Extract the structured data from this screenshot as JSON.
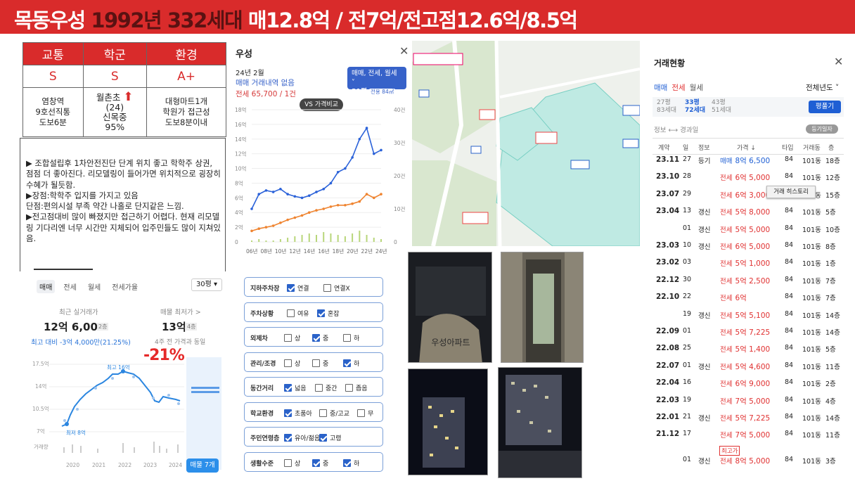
{
  "header": {
    "part1": "목동우성 ",
    "part2": "1992년 332세대",
    "part3": " 매12.8억 / 전7억/전고점12.6억/8.5억"
  },
  "grade_table": {
    "headers": [
      "교통",
      "학군",
      "환경"
    ],
    "grades": [
      "S",
      "S",
      "A+"
    ],
    "desc": [
      [
        "염창역",
        "9호선직통",
        "도보6분"
      ],
      [
        "월촌초",
        "(24)",
        "신목중",
        "95%"
      ],
      [
        "대형마트1개",
        "학원가 접근성",
        "도보8분이내"
      ]
    ],
    "arrow": "⬆"
  },
  "note": {
    "lines": [
      "▶ 조합설립후 1차안전진단 단계 위치 좋고 학학주 상권, 점점 더 좋아진다. 리모델링이 들어가면 위치적으로 굉장히 수혜가 될듯함.",
      "▶장점:학학주 입지를 가지고 있음",
      "단점:편의시설 부족 약간 나홀로 단지같은 느낌.",
      "▶전고점대비 많이 빠졌지만 접근하기 어렵다. 현재 리모델링 기다리엔 너무 시간만 지체되어 입주민들도 많이 지쳐있음."
    ]
  },
  "price_panel": {
    "tabs": [
      "매매",
      "전세",
      "월세",
      "전세가율"
    ],
    "pyeong_select": "30평 ▾",
    "recent_label": "최근 실거래가",
    "recent_value": "12억 6,000",
    "recent_floor": "2층",
    "min_label": "매물 최저가 >",
    "min_value": "13억",
    "min_floor": "4층",
    "recent_diff": "최고 대비 -3억 4,000만(21.25%)",
    "min_note": "4주 전 가격과 동일",
    "big_change": "-21%",
    "y_labels": [
      "17.5억",
      "14억",
      "10.5억",
      "7억",
      "거래량"
    ],
    "x_labels": [
      "2020",
      "2021",
      "2022",
      "2023",
      "2024"
    ],
    "peak_label": "최고 16억",
    "low_label": "최저 8억",
    "listing_button": "매물 7개"
  },
  "chart_panel": {
    "title": "우성",
    "close": "✕",
    "date": "24년 2월",
    "sub1": "매매 거래내역 없음",
    "sub2": "전세 65,700 / 1건",
    "type_btn_line1": "매매, 전세, 월세 ˅",
    "type_btn_py": "31평",
    "type_btn_area": "전용 84㎡",
    "vs_button": "VS 가격비교",
    "y_left": [
      "18억",
      "16억",
      "14억",
      "12억",
      "10억",
      "8억",
      "6억",
      "4억",
      "2억",
      "0"
    ],
    "y_right": [
      "40건",
      "30건",
      "20건",
      "10건",
      "0"
    ],
    "x_labels": [
      "06년",
      "08년",
      "10년",
      "12년",
      "14년",
      "16년",
      "18년",
      "20년",
      "22년",
      "24년"
    ]
  },
  "chart_data": {
    "type": "line",
    "x": [
      "06년",
      "07년",
      "08년",
      "09년",
      "10년",
      "11년",
      "12년",
      "13년",
      "14년",
      "15년",
      "16년",
      "17년",
      "18년",
      "19년",
      "20년",
      "21년",
      "22년",
      "23년",
      "24년"
    ],
    "series": [
      {
        "name": "매매",
        "values": [
          4.5,
          6.5,
          7.0,
          6.8,
          7.2,
          6.5,
          6.2,
          6.0,
          6.3,
          6.8,
          7.2,
          8.0,
          9.5,
          10.0,
          11.5,
          14.0,
          15.5,
          12.0,
          12.5
        ]
      },
      {
        "name": "전세",
        "values": [
          1.5,
          1.8,
          2.0,
          2.2,
          2.6,
          3.0,
          3.3,
          3.6,
          4.0,
          4.3,
          4.5,
          4.8,
          5.0,
          5.0,
          5.2,
          5.5,
          6.5,
          6.0,
          6.5
        ]
      }
    ],
    "ylim": [
      0,
      18
    ],
    "xlabel": "",
    "ylabel": ""
  },
  "checklist": [
    {
      "label": "지하주차장",
      "opts": [
        {
          "t": "연결",
          "on": true
        },
        {
          "t": "연결X",
          "on": false
        }
      ]
    },
    {
      "label": "주차상황",
      "opts": [
        {
          "t": "여유",
          "on": false
        },
        {
          "t": "혼잡",
          "on": true
        }
      ]
    },
    {
      "label": "외제차",
      "opts": [
        {
          "t": "상",
          "on": false
        },
        {
          "t": "중",
          "on": true
        },
        {
          "t": "하",
          "on": false
        }
      ]
    },
    {
      "label": "관리/조경",
      "opts": [
        {
          "t": "상",
          "on": false
        },
        {
          "t": "중",
          "on": false
        },
        {
          "t": "하",
          "on": true
        }
      ]
    },
    {
      "label": "동간거리",
      "opts": [
        {
          "t": "넓음",
          "on": true
        },
        {
          "t": "중간",
          "on": false
        },
        {
          "t": "좁음",
          "on": false
        }
      ]
    },
    {
      "label": "학교환경",
      "opts": [
        {
          "t": "초품아",
          "on": true
        },
        {
          "t": "중/고교",
          "on": false
        },
        {
          "t": "무",
          "on": false
        }
      ]
    },
    {
      "label": "주민연령층",
      "opts": [
        {
          "t": "유아/젊음",
          "on": true
        },
        {
          "t": "고령",
          "on": true
        }
      ]
    },
    {
      "label": "생활수준",
      "opts": [
        {
          "t": "상",
          "on": false
        },
        {
          "t": "중",
          "on": true
        },
        {
          "t": "하",
          "on": true
        }
      ]
    }
  ],
  "photo_sign": "우성아파트",
  "transactions": {
    "title": "거래현황",
    "close": "✕",
    "tabs": [
      "매매",
      "전세",
      "월세"
    ],
    "year_select": "전체년도 ˅",
    "py_options": [
      {
        "py": "27평",
        "units": "83세대"
      },
      {
        "py": "33평",
        "units": "72세대"
      },
      {
        "py": "43평",
        "units": "51세대"
      }
    ],
    "py_button": "평풀기",
    "info_label": "정보 ⟷ 경과일",
    "reg_badge": "등기일자",
    "headers": [
      "계약",
      "일",
      "정보",
      "가격 ↓",
      "타입",
      "거래동",
      "층"
    ],
    "tooltip": "거래 히스토리",
    "max_badge": "최고가",
    "rows": [
      {
        "date": "23.11",
        "day": "27",
        "info": "등기",
        "kind": "매매",
        "price": "8억 6,500",
        "type": "84",
        "dong": "101동",
        "floor": "18층"
      },
      {
        "date": "23.10",
        "day": "28",
        "info": "",
        "kind": "전세",
        "price": "6억 5,000",
        "type": "84",
        "dong": "101동",
        "floor": "12층"
      },
      {
        "date": "23.07",
        "day": "29",
        "info": "",
        "kind": "전세",
        "price": "6억 3,000",
        "type": "84",
        "dong": "101동",
        "floor": "15층"
      },
      {
        "date": "23.04",
        "day": "13",
        "info": "갱신",
        "kind": "전세",
        "price": "5억 8,000",
        "type": "84",
        "dong": "101동",
        "floor": "5층"
      },
      {
        "date": "",
        "day": "01",
        "info": "갱신",
        "kind": "전세",
        "price": "5억 5,000",
        "type": "84",
        "dong": "101동",
        "floor": "10층"
      },
      {
        "date": "23.03",
        "day": "10",
        "info": "갱신",
        "kind": "전세",
        "price": "6억 5,000",
        "type": "84",
        "dong": "101동",
        "floor": "8층"
      },
      {
        "date": "23.02",
        "day": "03",
        "info": "",
        "kind": "전세",
        "price": "5억 1,000",
        "type": "84",
        "dong": "101동",
        "floor": "1층"
      },
      {
        "date": "22.12",
        "day": "30",
        "info": "",
        "kind": "전세",
        "price": "5억 2,500",
        "type": "84",
        "dong": "101동",
        "floor": "7층"
      },
      {
        "date": "22.10",
        "day": "22",
        "info": "",
        "kind": "전세",
        "price": "6억",
        "type": "84",
        "dong": "101동",
        "floor": "7층"
      },
      {
        "date": "",
        "day": "19",
        "info": "갱신",
        "kind": "전세",
        "price": "5억 5,100",
        "type": "84",
        "dong": "101동",
        "floor": "14층"
      },
      {
        "date": "22.09",
        "day": "01",
        "info": "",
        "kind": "전세",
        "price": "5억 7,225",
        "type": "84",
        "dong": "101동",
        "floor": "14층"
      },
      {
        "date": "22.08",
        "day": "25",
        "info": "",
        "kind": "전세",
        "price": "5억 1,400",
        "type": "84",
        "dong": "101동",
        "floor": "5층"
      },
      {
        "date": "22.07",
        "day": "01",
        "info": "갱신",
        "kind": "전세",
        "price": "5억 4,600",
        "type": "84",
        "dong": "101동",
        "floor": "11층"
      },
      {
        "date": "22.04",
        "day": "16",
        "info": "",
        "kind": "전세",
        "price": "6억 9,000",
        "type": "84",
        "dong": "101동",
        "floor": "2층"
      },
      {
        "date": "22.03",
        "day": "19",
        "info": "",
        "kind": "전세",
        "price": "7억 5,000",
        "type": "84",
        "dong": "101동",
        "floor": "4층"
      },
      {
        "date": "22.01",
        "day": "21",
        "info": "갱신",
        "kind": "전세",
        "price": "5억 7,225",
        "type": "84",
        "dong": "101동",
        "floor": "14층"
      },
      {
        "date": "21.12",
        "day": "17",
        "info": "",
        "kind": "전세",
        "price": "7억 5,000",
        "type": "84",
        "dong": "101동",
        "floor": "11층"
      },
      {
        "date": "",
        "day": "01",
        "info": "갱신",
        "kind": "전세",
        "price": "8억 5,000",
        "type": "84",
        "dong": "101동",
        "floor": "3층"
      }
    ]
  }
}
